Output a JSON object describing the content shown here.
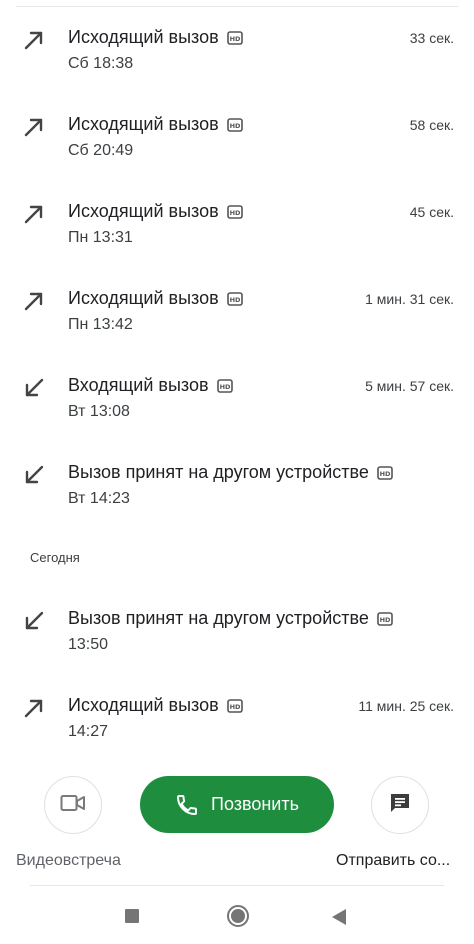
{
  "calls": [
    {
      "title": "Исходящий вызов",
      "time": "Сб 18:38",
      "duration": "33 сек.",
      "direction": "outgoing",
      "hd": true
    },
    {
      "title": "Исходящий вызов",
      "time": "Сб 20:49",
      "duration": "58 сек.",
      "direction": "outgoing",
      "hd": true
    },
    {
      "title": "Исходящий вызов",
      "time": "Пн 13:31",
      "duration": "45 сек.",
      "direction": "outgoing",
      "hd": true
    },
    {
      "title": "Исходящий вызов",
      "time": "Пн 13:42",
      "duration": "1 мин. 31 сек.",
      "direction": "outgoing",
      "hd": true
    },
    {
      "title": "Входящий вызов",
      "time": "Вт 13:08",
      "duration": "5 мин. 57 сек.",
      "direction": "incoming",
      "hd": true
    },
    {
      "title": "Вызов принят на другом устройстве",
      "time": "Вт 14:23",
      "duration": "",
      "direction": "incoming",
      "hd": true
    },
    {
      "title": "Вызов принят на другом устройстве",
      "time": "13:50",
      "duration": "",
      "direction": "incoming",
      "hd": true
    },
    {
      "title": "Исходящий вызов",
      "time": "14:27",
      "duration": "11 мин. 25 сек.",
      "direction": "outgoing",
      "hd": true
    }
  ],
  "section_header": "Сегодня",
  "actions": {
    "video_label": "Видеовстреча",
    "call_label": "Позвонить",
    "message_label": "Отправить со..."
  },
  "icons": {
    "outgoing": "arrow-up-right-icon",
    "incoming": "arrow-down-left-icon",
    "hd": "hd-icon",
    "video": "videocam-icon",
    "phone": "phone-icon",
    "message": "message-icon"
  },
  "colors": {
    "call_button": "#1e8e3e",
    "text_primary": "#202124",
    "text_secondary": "#3c4043",
    "icon": "#444444"
  }
}
